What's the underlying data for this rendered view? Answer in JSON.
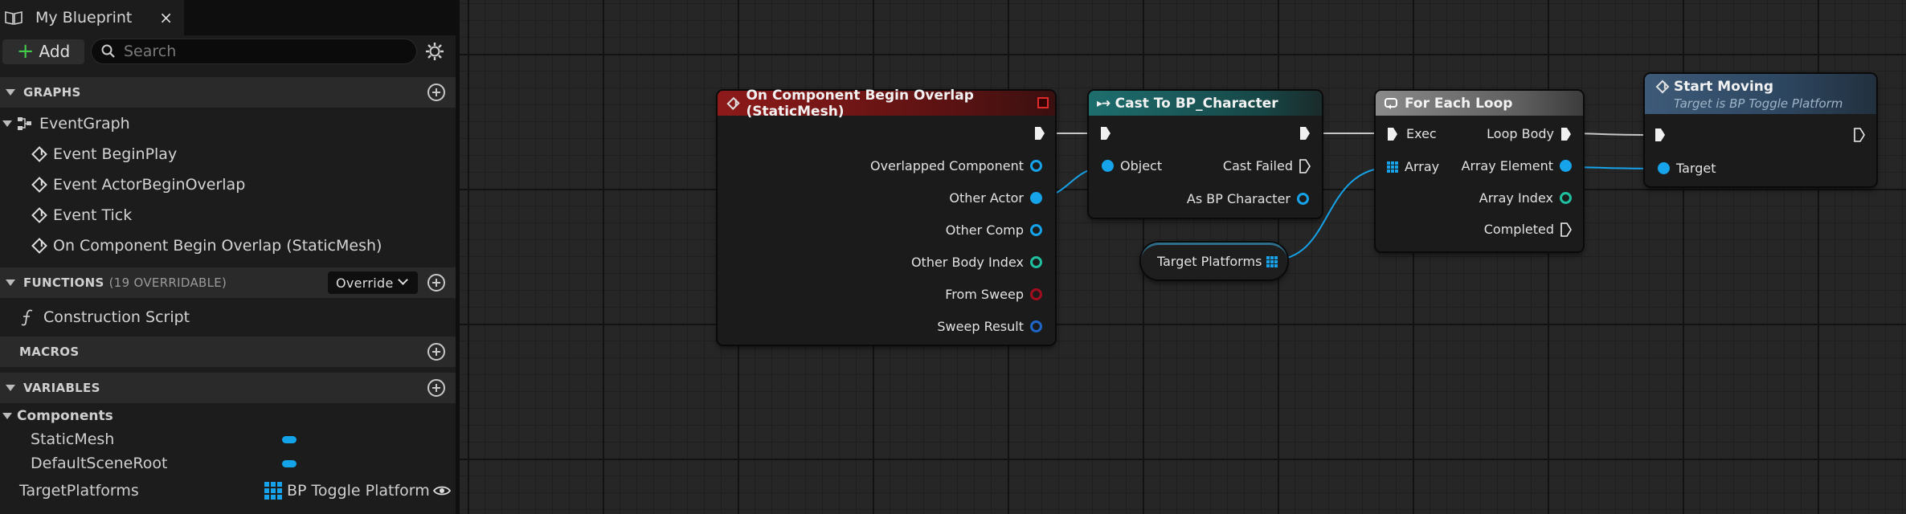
{
  "tab": {
    "title": "My Blueprint",
    "close": "×"
  },
  "toolbar": {
    "add_label": "Add",
    "search_placeholder": "Search"
  },
  "sections": {
    "graphs": "GRAPHS",
    "functions": "FUNCTIONS",
    "functions_sub": "(19 OVERRIDABLE)",
    "override": "Override",
    "macros": "MACROS",
    "variables": "VARIABLES"
  },
  "graphs": {
    "event_graph": "EventGraph",
    "events": [
      "Event BeginPlay",
      "Event ActorBeginOverlap",
      "Event Tick",
      "On Component Begin Overlap (StaticMesh)"
    ]
  },
  "functions": {
    "items": [
      "Construction Script"
    ]
  },
  "variables": {
    "category": "Components",
    "components": [
      "StaticMesh",
      "DefaultSceneRoot"
    ],
    "target_name": "TargetPlatforms",
    "target_type": "BP Toggle Platform"
  },
  "nodes": {
    "overlap": {
      "title": "On Component Begin Overlap (StaticMesh)",
      "pins": [
        "Overlapped Component",
        "Other Actor",
        "Other Comp",
        "Other Body Index",
        "From Sweep",
        "Sweep Result"
      ]
    },
    "cast": {
      "title": "Cast To BP_Character",
      "object": "Object",
      "cast_failed": "Cast Failed",
      "as_char": "As BP Character"
    },
    "target_platforms": {
      "label": "Target Platforms"
    },
    "foreach": {
      "title": "For Each Loop",
      "exec": "Exec",
      "array": "Array",
      "loop_body": "Loop Body",
      "array_element": "Array Element",
      "array_index": "Array Index",
      "completed": "Completed"
    },
    "start_moving": {
      "title": "Start Moving",
      "subtitle": "Target is BP Toggle Platform",
      "target": "Target"
    }
  },
  "colors": {
    "event_header": "#8e1a1a",
    "cast_header": "#1e6e6e",
    "loop_header": "#7a7a7a",
    "function_header": "#3d5a78",
    "object_pin": "#16a3ea",
    "int_pin": "#1fbf9f",
    "bool_pin": "#a20e1f",
    "add_green": "#45c94a"
  }
}
